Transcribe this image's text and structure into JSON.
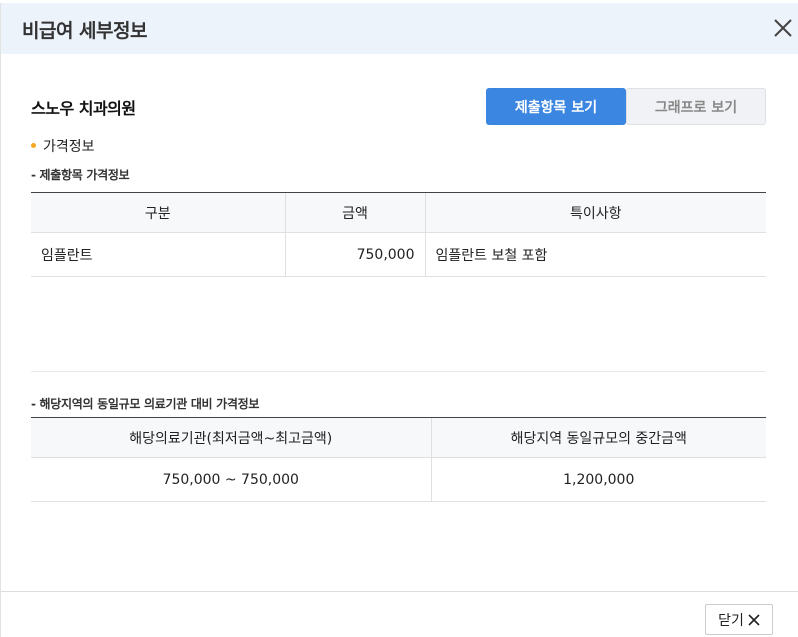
{
  "modal": {
    "title": "비급여 세부정보"
  },
  "clinic": {
    "name": "스노우 치과의원"
  },
  "view_buttons": {
    "submitted": "제출항목 보기",
    "graph": "그래프로 보기"
  },
  "section": {
    "title": "가격정보"
  },
  "submitted_table": {
    "title": "- 제출항목 가격정보",
    "headers": [
      "구분",
      "금액",
      "특이사항"
    ],
    "rows": [
      [
        "임플란트",
        "750,000",
        "임플란트 보철 포함"
      ]
    ]
  },
  "region_table": {
    "title": "- 해당지역의 동일규모 의료기관 대비 가격정보",
    "headers": [
      "해당의료기관(최저금액~최고금액)",
      "해당지역 동일규모의 중간금액"
    ],
    "rows": [
      [
        "750,000 ~ 750,000",
        "1,200,000"
      ]
    ]
  },
  "footer": {
    "close_label": "닫기"
  },
  "icons": {
    "close": "close-icon",
    "bullet": "dot-icon"
  },
  "colors": {
    "primary": "#3b86e0",
    "header_bg": "#edf3fb",
    "bullet": "#f5a623"
  }
}
